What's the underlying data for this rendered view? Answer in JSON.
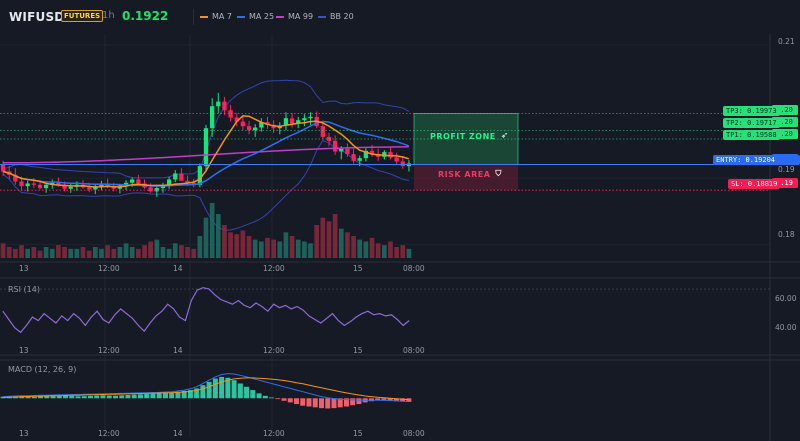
{
  "header": {
    "symbol": "WIFUSDT",
    "badge": "FUTURES",
    "interval": "1h",
    "price": "0.1922",
    "indicators": [
      {
        "label": "MA 7",
        "color": "#f7931a"
      },
      {
        "label": "MA 25",
        "color": "#2e6ef0"
      },
      {
        "label": "MA 99",
        "color": "#c03ec8"
      },
      {
        "label": "BB 20",
        "color": "#3b4fd0"
      }
    ]
  },
  "colors": {
    "up": "#26b5a0",
    "down": "#e0325c",
    "up_bright": "#15e67a",
    "down_bright": "#ff2060",
    "ma7": "#f7931a",
    "ma25": "#2e6ef0",
    "ma99": "#c03ec8",
    "bb": "#3b4fd0",
    "rsi": "#8e6ad8",
    "macd": "#2e6ef0",
    "signal": "#f7931a",
    "hist_up": "#2ec4a0",
    "hist_down": "#f0606c"
  },
  "trade": {
    "profit_label": "PROFIT ZONE",
    "risk_label": "RISK AREA",
    "profit_icon": "rocket-icon",
    "risk_icon": "shield-icon",
    "tp3": "TP3: 0.19973",
    "tp2": "TP2: 0.19717",
    "tp1": "TP1: 0.19588",
    "entry": "ENTRY: 0.19204",
    "sl": "SL: 0.18819"
  },
  "chart_data": [
    {
      "type": "candlestick",
      "title": "",
      "y_ticks": [
        "0.21",
        "0.19",
        "0.18"
      ],
      "x_ticks": [
        "13",
        "12:00",
        "14",
        "12:00",
        "15",
        "08:00"
      ],
      "axis_tags": [
        "0.20",
        "0.20",
        "0.20",
        "0.19",
        "0.19"
      ],
      "ylim": [
        0.178,
        0.2115
      ],
      "grid": true,
      "price_levels": {
        "tp3": 0.19973,
        "tp2": 0.19717,
        "tp1": 0.19588,
        "entry": 0.19204,
        "sl": 0.18819
      },
      "ohlc": [
        [
          0.192,
          0.1926,
          0.1903,
          0.191
        ],
        [
          0.191,
          0.1918,
          0.1898,
          0.1905
        ],
        [
          0.1905,
          0.1915,
          0.189,
          0.1895
        ],
        [
          0.1895,
          0.1902,
          0.1882,
          0.1888
        ],
        [
          0.1888,
          0.1896,
          0.188,
          0.1892
        ],
        [
          0.1892,
          0.19,
          0.1885,
          0.189
        ],
        [
          0.189,
          0.1897,
          0.1883,
          0.1885
        ],
        [
          0.1885,
          0.1893,
          0.1878,
          0.189
        ],
        [
          0.189,
          0.1898,
          0.1884,
          0.1893
        ],
        [
          0.1893,
          0.1901,
          0.1887,
          0.1889
        ],
        [
          0.1889,
          0.1895,
          0.188,
          0.1884
        ],
        [
          0.1884,
          0.1891,
          0.1878,
          0.1887
        ],
        [
          0.1887,
          0.1895,
          0.1881,
          0.189
        ],
        [
          0.189,
          0.1897,
          0.1884,
          0.1886
        ],
        [
          0.1886,
          0.1893,
          0.1879,
          0.1883
        ],
        [
          0.1883,
          0.189,
          0.1876,
          0.1888
        ],
        [
          0.1888,
          0.1896,
          0.1882,
          0.1892
        ],
        [
          0.1892,
          0.1899,
          0.1885,
          0.1887
        ],
        [
          0.1887,
          0.1893,
          0.188,
          0.1884
        ],
        [
          0.1884,
          0.1891,
          0.1877,
          0.1889
        ],
        [
          0.1889,
          0.1897,
          0.1882,
          0.1893
        ],
        [
          0.1893,
          0.1901,
          0.1887,
          0.1898
        ],
        [
          0.1898,
          0.1905,
          0.189,
          0.1892
        ],
        [
          0.1892,
          0.1898,
          0.1884,
          0.1886
        ],
        [
          0.1886,
          0.1892,
          0.1878,
          0.188
        ],
        [
          0.188,
          0.1888,
          0.1872,
          0.1885
        ],
        [
          0.1885,
          0.1893,
          0.1878,
          0.1889
        ],
        [
          0.1889,
          0.1902,
          0.1884,
          0.1898
        ],
        [
          0.1898,
          0.1912,
          0.1894,
          0.1907
        ],
        [
          0.1907,
          0.1915,
          0.19,
          0.1896
        ],
        [
          0.1896,
          0.1904,
          0.1888,
          0.1893
        ],
        [
          0.1893,
          0.1899,
          0.1886,
          0.189
        ],
        [
          0.189,
          0.1922,
          0.1886,
          0.1918
        ],
        [
          0.1918,
          0.198,
          0.1912,
          0.1975
        ],
        [
          0.1975,
          0.202,
          0.1962,
          0.2008
        ],
        [
          0.2008,
          0.2028,
          0.1998,
          0.2015
        ],
        [
          0.2015,
          0.2022,
          0.1995,
          0.2002
        ],
        [
          0.2002,
          0.201,
          0.1985,
          0.1991
        ],
        [
          0.1991,
          0.1998,
          0.1978,
          0.1985
        ],
        [
          0.1985,
          0.1995,
          0.1972,
          0.1978
        ],
        [
          0.1978,
          0.1986,
          0.1966,
          0.1972
        ],
        [
          0.1972,
          0.1981,
          0.1962,
          0.1976
        ],
        [
          0.1976,
          0.199,
          0.197,
          0.1984
        ],
        [
          0.1984,
          0.1992,
          0.1974,
          0.198
        ],
        [
          0.198,
          0.1987,
          0.1968,
          0.1975
        ],
        [
          0.1975,
          0.1984,
          0.1966,
          0.1979
        ],
        [
          0.1979,
          0.1999,
          0.1972,
          0.199
        ],
        [
          0.199,
          0.1998,
          0.1976,
          0.1982
        ],
        [
          0.1982,
          0.1992,
          0.1975,
          0.1987
        ],
        [
          0.1987,
          0.1996,
          0.1978,
          0.199
        ],
        [
          0.199,
          0.1999,
          0.198,
          0.1992
        ],
        [
          0.1992,
          0.2,
          0.1975,
          0.1978
        ],
        [
          0.1978,
          0.1984,
          0.1958,
          0.1962
        ],
        [
          0.1962,
          0.1968,
          0.1948,
          0.1956
        ],
        [
          0.1956,
          0.1964,
          0.1935,
          0.194
        ],
        [
          0.194,
          0.1948,
          0.1928,
          0.1944
        ],
        [
          0.1944,
          0.1952,
          0.1932,
          0.1936
        ],
        [
          0.1936,
          0.1944,
          0.1922,
          0.1926
        ],
        [
          0.1926,
          0.1934,
          0.1918,
          0.193
        ],
        [
          0.193,
          0.1945,
          0.1925,
          0.1941
        ],
        [
          0.1941,
          0.195,
          0.1932,
          0.1936
        ],
        [
          0.1936,
          0.1944,
          0.1926,
          0.1932
        ],
        [
          0.1932,
          0.1942,
          0.1928,
          0.1939
        ],
        [
          0.1939,
          0.1946,
          0.1928,
          0.1931
        ],
        [
          0.1931,
          0.1938,
          0.192,
          0.1925
        ],
        [
          0.1925,
          0.1933,
          0.1914,
          0.1918
        ],
        [
          0.1918,
          0.1927,
          0.191,
          0.1922
        ]
      ],
      "volume": [
        8,
        6,
        5,
        7,
        5,
        6,
        4,
        6,
        5,
        7,
        6,
        5,
        5,
        6,
        4,
        6,
        5,
        7,
        5,
        6,
        8,
        6,
        5,
        7,
        9,
        10,
        6,
        5,
        8,
        7,
        6,
        5,
        12,
        22,
        30,
        24,
        18,
        14,
        13,
        15,
        12,
        10,
        9,
        11,
        10,
        9,
        14,
        12,
        10,
        9,
        8,
        18,
        22,
        20,
        24,
        16,
        14,
        12,
        10,
        9,
        11,
        8,
        7,
        9,
        6,
        7,
        5
      ]
    },
    {
      "type": "line",
      "title": "RSI (14)",
      "y_ticks": [
        "60.00",
        "40.00"
      ],
      "x_ticks": [
        "13",
        "12:00",
        "14",
        "12:00",
        "15",
        "08:00"
      ],
      "ylim": [
        25,
        76
      ],
      "values": [
        52,
        45,
        38,
        34,
        40,
        47,
        44,
        50,
        46,
        42,
        48,
        44,
        50,
        46,
        40,
        47,
        52,
        45,
        42,
        49,
        54,
        50,
        46,
        40,
        35,
        42,
        48,
        52,
        58,
        54,
        47,
        44,
        61,
        70,
        72,
        71,
        66,
        62,
        60,
        58,
        61,
        57,
        55,
        59,
        56,
        52,
        58,
        55,
        57,
        54,
        56,
        53,
        48,
        45,
        42,
        46,
        50,
        44,
        40,
        43,
        47,
        50,
        52,
        49,
        50,
        48,
        49,
        45,
        40,
        44
      ]
    },
    {
      "type": "bar+line",
      "title": "MACD (12, 26, 9)",
      "x_ticks": [
        "13",
        "12:00",
        "14",
        "12:00",
        "15",
        "08:00"
      ],
      "ylim": [
        -0.0012,
        0.0016
      ],
      "histogram": [
        0.0001,
        0.00012,
        0.00015,
        0.00013,
        0.0001,
        9e-05,
        0.00011,
        0.00012,
        0.00014,
        0.00015,
        0.00016,
        0.00014,
        0.00012,
        0.00013,
        0.00015,
        0.00016,
        0.00018,
        0.00017,
        0.00016,
        0.00018,
        0.0002,
        0.00022,
        0.00024,
        0.00026,
        0.00028,
        0.0003,
        0.00033,
        0.00036,
        0.0004,
        0.00045,
        0.0005,
        0.0006,
        0.0008,
        0.001,
        0.0012,
        0.0013,
        0.00125,
        0.0011,
        0.0009,
        0.0007,
        0.0005,
        0.0003,
        0.00015,
        5e-05,
        -5e-05,
        -0.00015,
        -0.00025,
        -0.00035,
        -0.00045,
        -0.0005,
        -0.00055,
        -0.0006,
        -0.00062,
        -0.0006,
        -0.00055,
        -0.0005,
        -0.00042,
        -0.00035,
        -0.00025,
        -0.00018,
        -0.00012,
        -0.0001,
        -0.00015,
        -0.00018,
        -0.0002,
        -0.00022
      ],
      "macd": [
        0.0001,
        0.00012,
        0.00014,
        0.00015,
        0.00016,
        0.00017,
        0.00018,
        0.00019,
        0.0002,
        0.00021,
        0.00022,
        0.00023,
        0.00023,
        0.00024,
        0.00025,
        0.00026,
        0.00027,
        0.00028,
        0.00029,
        0.0003,
        0.00031,
        0.00032,
        0.00033,
        0.00034,
        0.00035,
        0.00036,
        0.00038,
        0.0004,
        0.00045,
        0.0005,
        0.00058,
        0.0007,
        0.0009,
        0.0011,
        0.0013,
        0.00145,
        0.0015,
        0.00148,
        0.0014,
        0.0013,
        0.0012,
        0.0011,
        0.001,
        0.0009,
        0.0008,
        0.0007,
        0.0006,
        0.0005,
        0.0004,
        0.0003,
        0.0002,
        0.0001,
        3e-05,
        -2e-05,
        -6e-05,
        -8e-05,
        -0.0001,
        -0.00011,
        -0.00012,
        -0.00012,
        -0.00012,
        -0.00013,
        -0.00014,
        -0.00016,
        -0.00018,
        -0.0002
      ],
      "signal": [
        5e-05,
        6e-05,
        8e-05,
        0.0001,
        0.00011,
        0.00012,
        0.00013,
        0.00014,
        0.00015,
        0.00016,
        0.00017,
        0.00018,
        0.00019,
        0.0002,
        0.00021,
        0.00022,
        0.00023,
        0.00024,
        0.00025,
        0.00026,
        0.00027,
        0.00028,
        0.00029,
        0.0003,
        0.00031,
        0.00032,
        0.00033,
        0.00034,
        0.00036,
        0.00038,
        0.00042,
        0.00048,
        0.00058,
        0.0007,
        0.00085,
        0.001,
        0.0011,
        0.00118,
        0.00122,
        0.00124,
        0.00124,
        0.00122,
        0.0012,
        0.00117,
        0.00113,
        0.00108,
        0.00102,
        0.00095,
        0.00088,
        0.0008,
        0.00072,
        0.00064,
        0.00056,
        0.00048,
        0.0004,
        0.00033,
        0.00026,
        0.0002,
        0.00014,
        0.0001,
        6e-05,
        3e-05,
        0.0,
        -3e-05,
        -6e-05,
        -9e-05
      ]
    }
  ]
}
